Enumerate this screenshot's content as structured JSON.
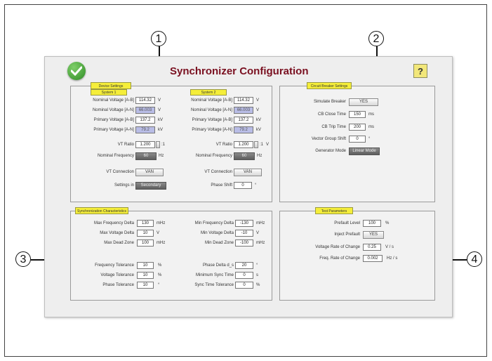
{
  "title": "Synchronizer Configuration",
  "help_label": "?",
  "callouts": [
    "1",
    "2",
    "3",
    "4"
  ],
  "icons": {
    "status": "green-check-icon",
    "help": "help-icon"
  },
  "device_settings": {
    "title": "Device Settings",
    "system1": {
      "title": "System 1",
      "nominal_voltage_ab": {
        "label": "Nominal Voltage [A-B]",
        "value": "114.32",
        "unit": "V"
      },
      "nominal_voltage_an": {
        "label": "Nominal Voltage [A-N]",
        "value": "66.003",
        "unit": "V"
      },
      "primary_voltage_ab": {
        "label": "Primary Voltage [A-B]",
        "value": "137.2",
        "unit": "kV"
      },
      "primary_voltage_an": {
        "label": "Primary Voltage [A-N]",
        "value": "79.2",
        "unit": "kV"
      },
      "vt_ratio": {
        "label": "VT Ratio",
        "value": "1.200",
        "unit": ":1"
      },
      "nominal_frequency": {
        "label": "Nominal Frequency",
        "value": "60",
        "unit": "Hz"
      },
      "vt_connection": {
        "label": "VT Connection",
        "value": "VAN"
      },
      "settings_in": {
        "label": "Settings in",
        "value": "Secondary"
      }
    },
    "system2": {
      "title": "System 2",
      "nominal_voltage_ab": {
        "label": "Nominal Voltage [A-B]",
        "value": "114.32",
        "unit": "V"
      },
      "nominal_voltage_an": {
        "label": "Nominal Voltage [A-N]",
        "value": "66.003",
        "unit": "V"
      },
      "primary_voltage_ab": {
        "label": "Primary Voltage [A-B]",
        "value": "137.2",
        "unit": "kV"
      },
      "primary_voltage_an": {
        "label": "Primary Voltage [A-N]",
        "value": "79.2",
        "unit": "kV"
      },
      "vt_ratio": {
        "label": "VT Ratio",
        "value": "1.200",
        "unit": ":1",
        "unit2": "V"
      },
      "nominal_frequency": {
        "label": "Nominal Frequency",
        "value": "60",
        "unit": "Hz"
      },
      "vt_connection": {
        "label": "VT Connection",
        "value": "VAN"
      },
      "phase_shift": {
        "label": "Phase Shift",
        "value": "0",
        "unit": "°"
      }
    }
  },
  "circuit_breaker": {
    "title": "Circuit Breaker Settings",
    "simulate_breaker": {
      "label": "Simulate Breaker",
      "value": "YES"
    },
    "cb_close_time": {
      "label": "CB Close Time",
      "value": "150",
      "unit": "ms"
    },
    "cb_trip_time": {
      "label": "CB Trip Time",
      "value": "200",
      "unit": "ms"
    },
    "vector_group_shift": {
      "label": "Vector Group Shift",
      "value": "0",
      "unit": "°"
    },
    "generator_mode": {
      "label": "Generator Mode",
      "value": "Linear Mode"
    }
  },
  "sync": {
    "title": "Synchronization Characteristics",
    "max_freq_delta": {
      "label": "Max Frequency Delta",
      "value": "130",
      "unit": "mHz"
    },
    "max_voltage_delta": {
      "label": "Max Voltage Delta",
      "value": "10",
      "unit": "V"
    },
    "max_dead_zone": {
      "label": "Max Dead Zone",
      "value": "100",
      "unit": "mHz"
    },
    "min_freq_delta": {
      "label": "Min Frequency Delta",
      "value": "-130",
      "unit": "mHz"
    },
    "min_voltage_delta": {
      "label": "Min Voltage Delta",
      "value": "-10",
      "unit": "V"
    },
    "min_dead_zone": {
      "label": "Min Dead Zone",
      "value": "-100",
      "unit": "mHz"
    },
    "freq_tolerance": {
      "label": "Frequency Tolerance",
      "value": "10",
      "unit": "%"
    },
    "voltage_tolerance": {
      "label": "Voltage Tolerance",
      "value": "10",
      "unit": "%"
    },
    "phase_tolerance": {
      "label": "Phase Tolerance",
      "value": "10",
      "unit": "°"
    },
    "phase_delta": {
      "label": "Phase Delta d_s",
      "value": "20",
      "unit": "°"
    },
    "min_sync_time": {
      "label": "Minimum Sync Time",
      "value": "0",
      "unit": "s"
    },
    "sync_time_tolerance": {
      "label": "Sync Time Tolerance",
      "value": "0",
      "unit": "%"
    }
  },
  "test": {
    "title": "Test Parameters",
    "prefault_level": {
      "label": "Prefault Level",
      "value": "100",
      "unit": "%"
    },
    "inject_prefault": {
      "label": "Inject Prefault",
      "value": "YES"
    },
    "voltage_rate": {
      "label": "Voltage Rate of Change",
      "value": "0.25",
      "unit": "V / s"
    },
    "freq_rate": {
      "label": "Freq. Rate of Change",
      "value": "0.002",
      "unit": "Hz / s"
    }
  }
}
